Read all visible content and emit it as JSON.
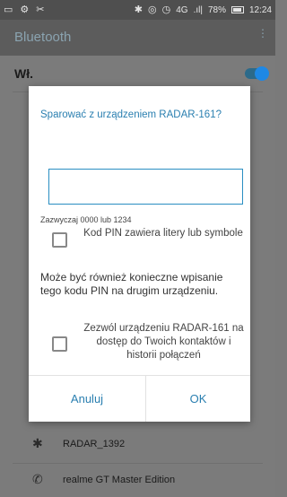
{
  "status_bar": {
    "left_icons": [
      "image-icon",
      "settings-app-icon",
      "tool-icon"
    ],
    "right_icons": [
      "bluetooth-icon",
      "sync-icon",
      "alarm-icon"
    ],
    "network": "4G",
    "signal": ".ıl|",
    "battery": "78%",
    "time": "12:24"
  },
  "app_bar": {
    "title": "Bluetooth"
  },
  "toggle": {
    "label": "Wł.",
    "state": "on"
  },
  "dialog": {
    "title": "Sparować z urządzeniem RADAR-161?",
    "pin_value": "",
    "pin_hint": "Zazwyczaj 0000 lub 1234",
    "checkbox_pin_label": "Kod PIN zawiera litery lub symbole",
    "note": "Może być również konieczne wpisanie tego kodu PIN na drugim urządzeniu.",
    "checkbox_contacts_label": "Zezwól urządzeniu RADAR-161 na dostęp do Twoich kontaktów i historii połączeń",
    "cancel_label": "Anuluj",
    "ok_label": "OK"
  },
  "devices": [
    {
      "name": "RADAR_1392",
      "icon": "bluetooth-icon"
    },
    {
      "name": "realme GT Master Edition",
      "icon": "phone-icon"
    }
  ],
  "colors": {
    "accent": "#2a7fb0",
    "switch": "#1e88e5"
  }
}
